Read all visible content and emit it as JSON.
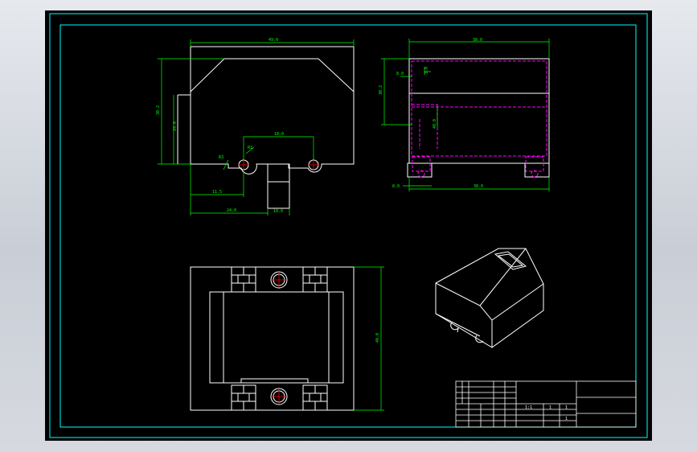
{
  "colors": {
    "sheet_border": "#00ffff",
    "outline": "#ffffff",
    "dimension": "#00ff00",
    "hidden_line": "#ff00ff",
    "centerline": "#ff0000",
    "background": "#000000"
  },
  "front_view": {
    "dims": {
      "overall_width": "49.0",
      "overall_height": "30.2",
      "inner_height": "24.0",
      "hole_spacing": "18.0",
      "hole_dia": "R3",
      "slot_radius": "R3",
      "left_offset": "11.5",
      "left_to_post": "24.0",
      "post_width": "10.0"
    }
  },
  "side_view": {
    "dims": {
      "top_width": "38.0",
      "overall_height": "30.2",
      "left_step": "8.0",
      "top_step": "3.0",
      "inner_dim": "40.0",
      "foot_width": "8.0",
      "base_width": "38.0"
    }
  },
  "plan_view": {
    "dims": {
      "depth": "40.0"
    }
  },
  "title_block": {
    "cells": [
      "1:1",
      "1",
      "1",
      "1"
    ]
  }
}
